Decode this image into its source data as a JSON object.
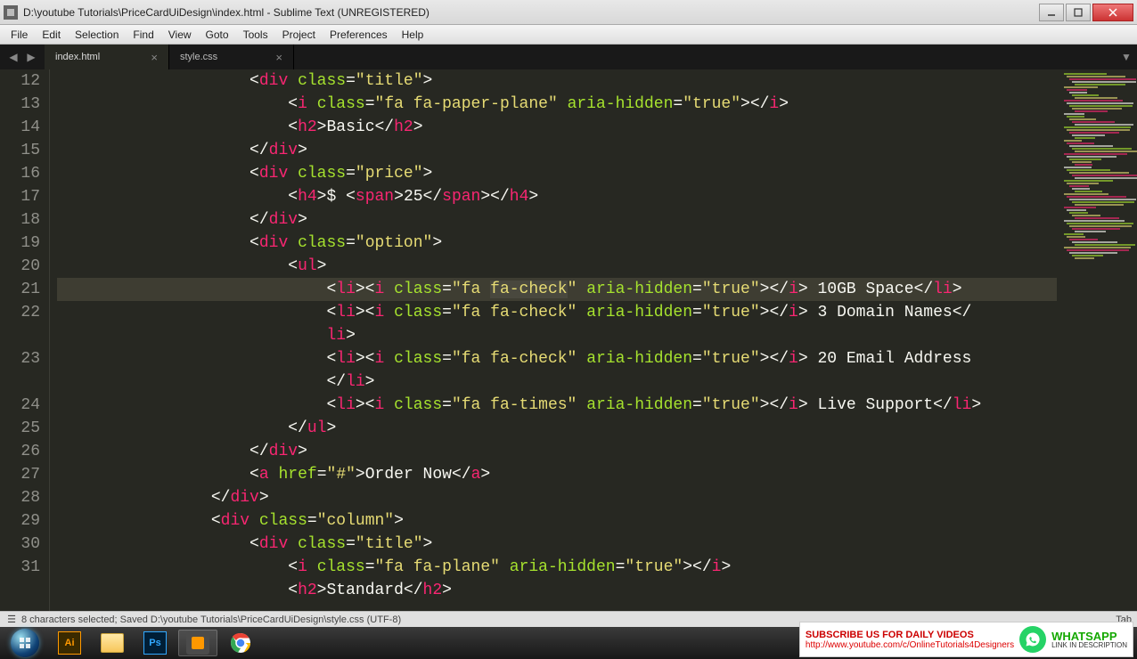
{
  "window": {
    "title": "D:\\youtube Tutorials\\PriceCardUiDesign\\index.html - Sublime Text (UNREGISTERED)"
  },
  "menu": {
    "items": [
      "File",
      "Edit",
      "Selection",
      "Find",
      "View",
      "Goto",
      "Tools",
      "Project",
      "Preferences",
      "Help"
    ]
  },
  "tabs": {
    "items": [
      {
        "label": "index.html",
        "active": true
      },
      {
        "label": "style.css",
        "active": false
      }
    ]
  },
  "gutter_lines": [
    "12",
    "13",
    "14",
    "15",
    "16",
    "17",
    "18",
    "19",
    "20",
    "21",
    "22",
    "",
    "23",
    "",
    "24",
    "25",
    "26",
    "27",
    "28",
    "29",
    "30",
    "31",
    ""
  ],
  "code_lines": [
    {
      "indent": 20,
      "parts": [
        [
          "punct",
          "<"
        ],
        [
          "tag",
          "div"
        ],
        [
          "txt",
          " "
        ],
        [
          "attrn",
          "class"
        ],
        [
          "eq",
          "="
        ],
        [
          "str",
          "\"title\""
        ],
        [
          "punct",
          ">"
        ]
      ]
    },
    {
      "indent": 24,
      "parts": [
        [
          "punct",
          "<"
        ],
        [
          "tag",
          "i"
        ],
        [
          "txt",
          " "
        ],
        [
          "attrn",
          "class"
        ],
        [
          "eq",
          "="
        ],
        [
          "str",
          "\"fa fa-paper-plane\""
        ],
        [
          "txt",
          " "
        ],
        [
          "attrn",
          "aria-hidden"
        ],
        [
          "eq",
          "="
        ],
        [
          "str",
          "\"true\""
        ],
        [
          "punct",
          "></"
        ],
        [
          "tag",
          "i"
        ],
        [
          "punct",
          ">"
        ]
      ]
    },
    {
      "indent": 24,
      "parts": [
        [
          "punct",
          "<"
        ],
        [
          "tag",
          "h2"
        ],
        [
          "punct",
          ">"
        ],
        [
          "txt",
          "Basic"
        ],
        [
          "punct",
          "</"
        ],
        [
          "tag",
          "h2"
        ],
        [
          "punct",
          ">"
        ]
      ]
    },
    {
      "indent": 20,
      "parts": [
        [
          "punct",
          "</"
        ],
        [
          "tag",
          "div"
        ],
        [
          "punct",
          ">"
        ]
      ]
    },
    {
      "indent": 20,
      "parts": [
        [
          "punct",
          "<"
        ],
        [
          "tag",
          "div"
        ],
        [
          "txt",
          " "
        ],
        [
          "attrn",
          "class"
        ],
        [
          "eq",
          "="
        ],
        [
          "str",
          "\"price\""
        ],
        [
          "punct",
          ">"
        ]
      ]
    },
    {
      "indent": 24,
      "parts": [
        [
          "punct",
          "<"
        ],
        [
          "tag",
          "h4"
        ],
        [
          "punct",
          ">"
        ],
        [
          "txt",
          "$ "
        ],
        [
          "punct",
          "<"
        ],
        [
          "tag",
          "span"
        ],
        [
          "punct",
          ">"
        ],
        [
          "txt",
          "25"
        ],
        [
          "punct",
          "</"
        ],
        [
          "tag",
          "span"
        ],
        [
          "punct",
          "></"
        ],
        [
          "tag",
          "h4"
        ],
        [
          "punct",
          ">"
        ]
      ]
    },
    {
      "indent": 20,
      "parts": [
        [
          "punct",
          "</"
        ],
        [
          "tag",
          "div"
        ],
        [
          "punct",
          ">"
        ]
      ]
    },
    {
      "indent": 20,
      "parts": [
        [
          "punct",
          "<"
        ],
        [
          "tag",
          "div"
        ],
        [
          "txt",
          " "
        ],
        [
          "attrn",
          "class"
        ],
        [
          "eq",
          "="
        ],
        [
          "str",
          "\"option\""
        ],
        [
          "punct",
          ">"
        ]
      ]
    },
    {
      "indent": 24,
      "parts": [
        [
          "punct",
          "<"
        ],
        [
          "tag",
          "ul"
        ],
        [
          "punct",
          ">"
        ]
      ]
    },
    {
      "indent": 28,
      "hl": true,
      "parts": [
        [
          "punct",
          "<"
        ],
        [
          "tag",
          "li"
        ],
        [
          "punct",
          "><"
        ],
        [
          "tag",
          "i"
        ],
        [
          "txt",
          " "
        ],
        [
          "attrn",
          "class"
        ],
        [
          "eq",
          "="
        ],
        [
          "str",
          "\"fa "
        ],
        [
          "strsel",
          "fa-check"
        ],
        [
          "str",
          "\""
        ],
        [
          "txt",
          " "
        ],
        [
          "attrn",
          "aria-hidden"
        ],
        [
          "eq",
          "="
        ],
        [
          "str",
          "\"true\""
        ],
        [
          "punct",
          "></"
        ],
        [
          "tag",
          "i"
        ],
        [
          "punct",
          ">"
        ],
        [
          "txt",
          " 10GB Space"
        ],
        [
          "punct",
          "</"
        ],
        [
          "tag",
          "li"
        ],
        [
          "punct",
          ">"
        ]
      ]
    },
    {
      "indent": 28,
      "parts": [
        [
          "punct",
          "<"
        ],
        [
          "tag",
          "li"
        ],
        [
          "punct",
          "><"
        ],
        [
          "tag",
          "i"
        ],
        [
          "txt",
          " "
        ],
        [
          "attrn",
          "class"
        ],
        [
          "eq",
          "="
        ],
        [
          "str",
          "\"fa fa-check\""
        ],
        [
          "txt",
          " "
        ],
        [
          "attrn",
          "aria-hidden"
        ],
        [
          "eq",
          "="
        ],
        [
          "str",
          "\"true\""
        ],
        [
          "punct",
          "></"
        ],
        [
          "tag",
          "i"
        ],
        [
          "punct",
          ">"
        ],
        [
          "txt",
          " 3 Domain Names"
        ],
        [
          "punct",
          "</"
        ]
      ]
    },
    {
      "indent": 28,
      "parts": [
        [
          "tag",
          "li"
        ],
        [
          "punct",
          ">"
        ]
      ]
    },
    {
      "indent": 28,
      "parts": [
        [
          "punct",
          "<"
        ],
        [
          "tag",
          "li"
        ],
        [
          "punct",
          "><"
        ],
        [
          "tag",
          "i"
        ],
        [
          "txt",
          " "
        ],
        [
          "attrn",
          "class"
        ],
        [
          "eq",
          "="
        ],
        [
          "str",
          "\"fa fa-check\""
        ],
        [
          "txt",
          " "
        ],
        [
          "attrn",
          "aria-hidden"
        ],
        [
          "eq",
          "="
        ],
        [
          "str",
          "\"true\""
        ],
        [
          "punct",
          "></"
        ],
        [
          "tag",
          "i"
        ],
        [
          "punct",
          ">"
        ],
        [
          "txt",
          " 20 Email Address"
        ]
      ]
    },
    {
      "indent": 28,
      "parts": [
        [
          "punct",
          "</"
        ],
        [
          "tag",
          "li"
        ],
        [
          "punct",
          ">"
        ]
      ]
    },
    {
      "indent": 28,
      "parts": [
        [
          "punct",
          "<"
        ],
        [
          "tag",
          "li"
        ],
        [
          "punct",
          "><"
        ],
        [
          "tag",
          "i"
        ],
        [
          "txt",
          " "
        ],
        [
          "attrn",
          "class"
        ],
        [
          "eq",
          "="
        ],
        [
          "str",
          "\"fa fa-times\""
        ],
        [
          "txt",
          " "
        ],
        [
          "attrn",
          "aria-hidden"
        ],
        [
          "eq",
          "="
        ],
        [
          "str",
          "\"true\""
        ],
        [
          "punct",
          "></"
        ],
        [
          "tag",
          "i"
        ],
        [
          "punct",
          ">"
        ],
        [
          "txt",
          " Live Support"
        ],
        [
          "punct",
          "</"
        ],
        [
          "tag",
          "li"
        ],
        [
          "punct",
          ">"
        ]
      ]
    },
    {
      "indent": 24,
      "parts": [
        [
          "punct",
          "</"
        ],
        [
          "tag",
          "ul"
        ],
        [
          "punct",
          ">"
        ]
      ]
    },
    {
      "indent": 20,
      "parts": [
        [
          "punct",
          "</"
        ],
        [
          "tag",
          "div"
        ],
        [
          "punct",
          ">"
        ]
      ]
    },
    {
      "indent": 20,
      "parts": [
        [
          "punct",
          "<"
        ],
        [
          "tag",
          "a"
        ],
        [
          "txt",
          " "
        ],
        [
          "attrn",
          "href"
        ],
        [
          "eq",
          "="
        ],
        [
          "str",
          "\"#\""
        ],
        [
          "punct",
          ">"
        ],
        [
          "txt",
          "Order Now"
        ],
        [
          "punct",
          "</"
        ],
        [
          "tag",
          "a"
        ],
        [
          "punct",
          ">"
        ]
      ]
    },
    {
      "indent": 16,
      "parts": [
        [
          "punct",
          "</"
        ],
        [
          "tag",
          "div"
        ],
        [
          "punct",
          ">"
        ]
      ]
    },
    {
      "indent": 16,
      "parts": [
        [
          "punct",
          "<"
        ],
        [
          "tag",
          "div"
        ],
        [
          "txt",
          " "
        ],
        [
          "attrn",
          "class"
        ],
        [
          "eq",
          "="
        ],
        [
          "str",
          "\"column\""
        ],
        [
          "punct",
          ">"
        ]
      ]
    },
    {
      "indent": 20,
      "parts": [
        [
          "punct",
          "<"
        ],
        [
          "tag",
          "div"
        ],
        [
          "txt",
          " "
        ],
        [
          "attrn",
          "class"
        ],
        [
          "eq",
          "="
        ],
        [
          "str",
          "\"title\""
        ],
        [
          "punct",
          ">"
        ]
      ]
    },
    {
      "indent": 24,
      "parts": [
        [
          "punct",
          "<"
        ],
        [
          "tag",
          "i"
        ],
        [
          "txt",
          " "
        ],
        [
          "attrn",
          "class"
        ],
        [
          "eq",
          "="
        ],
        [
          "str",
          "\"fa fa-plane\""
        ],
        [
          "txt",
          " "
        ],
        [
          "attrn",
          "aria-hidden"
        ],
        [
          "eq",
          "="
        ],
        [
          "str",
          "\"true\""
        ],
        [
          "punct",
          "></"
        ],
        [
          "tag",
          "i"
        ],
        [
          "punct",
          ">"
        ]
      ]
    },
    {
      "indent": 24,
      "cut": true,
      "parts": [
        [
          "punct",
          "<"
        ],
        [
          "tag",
          "h2"
        ],
        [
          "punct",
          ">"
        ],
        [
          "txt",
          "Standard"
        ],
        [
          "punct",
          "</"
        ],
        [
          "tag",
          "h2"
        ],
        [
          "punct",
          ">"
        ]
      ]
    }
  ],
  "status": {
    "text": "8 characters selected; Saved D:\\youtube Tutorials\\PriceCardUiDesign\\style.css (UTF-8)",
    "right": "Tab"
  },
  "taskbar": {
    "icons": [
      "illustrator",
      "explorer",
      "photoshop",
      "sublime",
      "chrome"
    ]
  },
  "promo": {
    "headline": "SUBSCRIBE US FOR DAILY VIDEOS",
    "url": "http://www.youtube.com/c/OnlineTutorials4Designers",
    "whatsapp_title": "WHATSAPP",
    "whatsapp_sub": "LINK IN DESCRIPTION"
  }
}
